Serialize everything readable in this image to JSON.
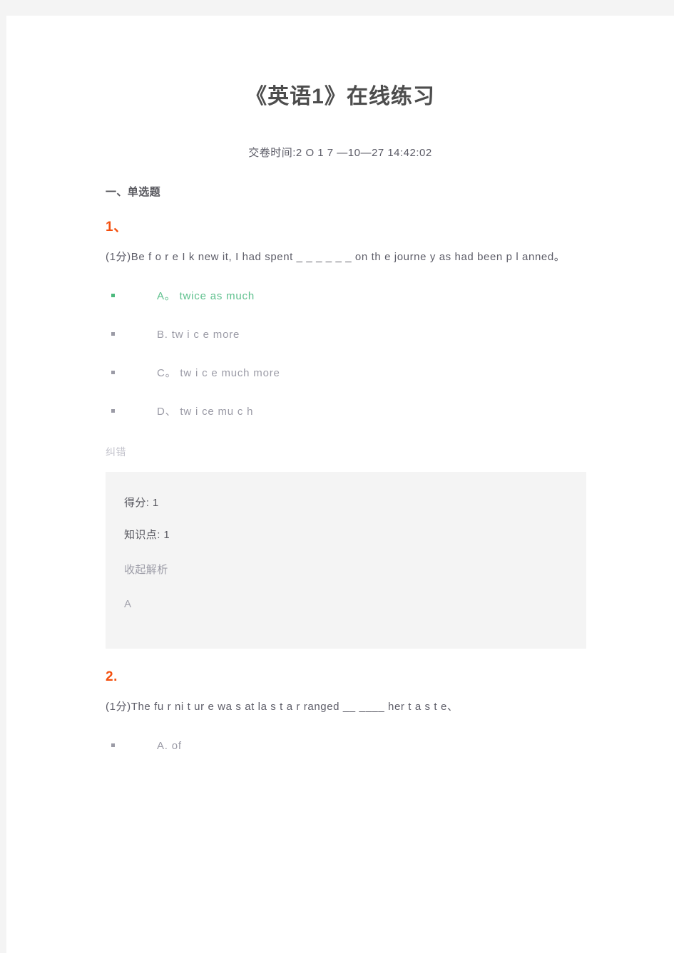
{
  "document": {
    "title": "《英语1》在线练习",
    "subtitle": "交卷时间:2 O 1 7 —10—27  14:42:02"
  },
  "sections": [
    {
      "heading": "一、单选题",
      "questions": [
        {
          "number": "1、",
          "score_tag": "(1分)",
          "text": "(1分)Be f o r e  I  k new  it,  I  had  spent  _ _ _ _ _ _  on   th e   journe y   as  had   been   p l anned。",
          "options": [
            {
              "label": "A。  twice   as much",
              "correct": true
            },
            {
              "label": "B. tw i c e   more",
              "correct": false
            },
            {
              "label": "C。  tw i c e  much more",
              "correct": false
            },
            {
              "label": "D、  tw i ce   mu c h",
              "correct": false
            }
          ],
          "report_label": "纠错",
          "analysis": {
            "score_label": "得分: 1",
            "knowledge_label": "知识点: 1",
            "toggle_label": "收起解析",
            "answer": "A"
          }
        },
        {
          "number": "2.",
          "score_tag": "(1分)",
          "text": "(1分)The  fu r ni t ur e  wa s  at   la s t   a r ranged  __ ____   her  t a s t e、",
          "options": [
            {
              "label": "A. of",
              "correct": false
            }
          ]
        }
      ]
    }
  ],
  "colors": {
    "page_background": "#f4f4f4",
    "sheet_background": "#ffffff",
    "title_text": "#4d4d4d",
    "body_text": "#5d5d68",
    "muted_text": "#9b9ba6",
    "accent_orange": "#f4500f",
    "correct_green": "#4cb97d",
    "analysis_background": "#f4f4f4"
  }
}
